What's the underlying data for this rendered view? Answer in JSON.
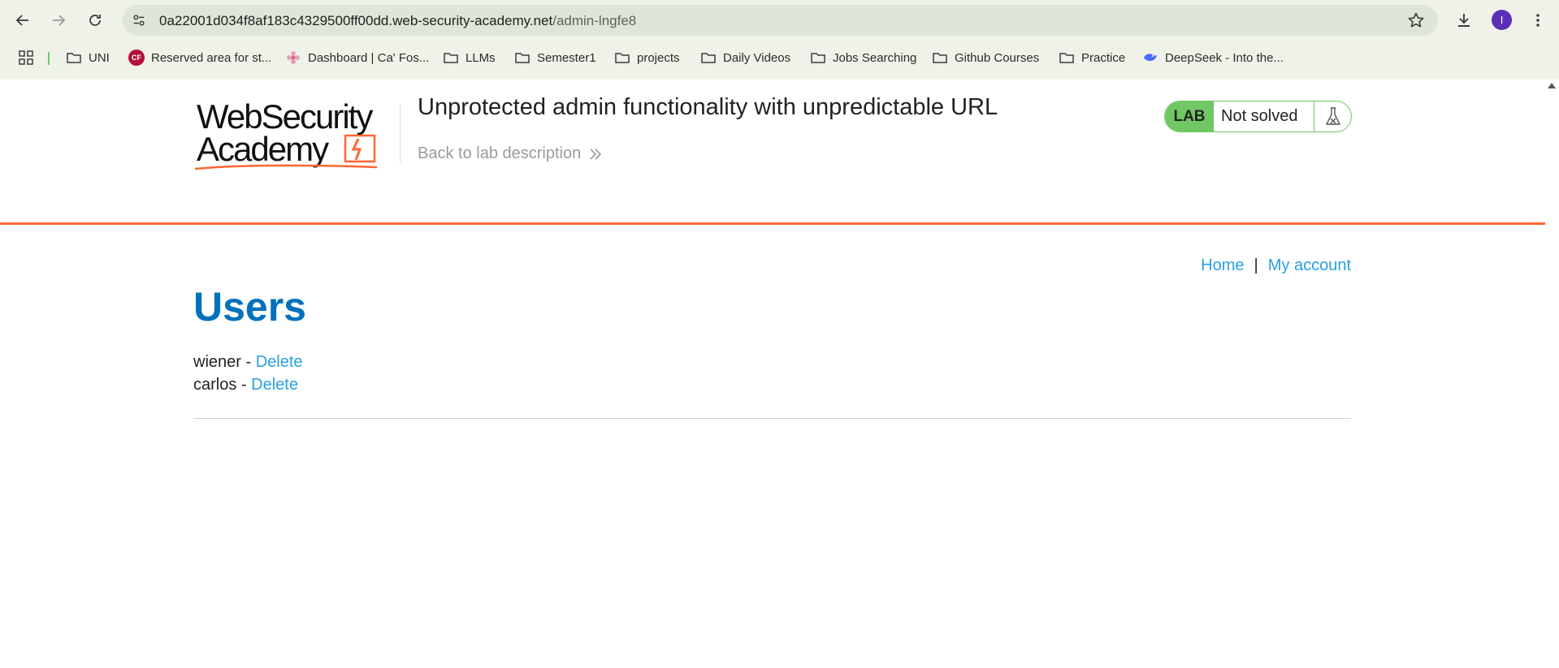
{
  "browser": {
    "url_host": "0a22001d034f8af183c4329500ff00dd.web-security-academy.net",
    "url_path": "/admin-lngfe8",
    "avatar_letter": "I",
    "bookmarks": [
      {
        "label": "UNI",
        "icon": "folder-icon"
      },
      {
        "label": "Reserved area for st...",
        "icon": "cf-favicon"
      },
      {
        "label": "Dashboard | Ca' Fos...",
        "icon": "flower-favicon"
      },
      {
        "label": "LLMs",
        "icon": "folder-icon"
      },
      {
        "label": "Semester1",
        "icon": "folder-icon"
      },
      {
        "label": "projects",
        "icon": "folder-icon"
      },
      {
        "label": "Daily Videos",
        "icon": "folder-icon"
      },
      {
        "label": "Jobs Searching",
        "icon": "folder-icon"
      },
      {
        "label": "Github Courses",
        "icon": "folder-icon"
      },
      {
        "label": "Practice",
        "icon": "folder-icon"
      },
      {
        "label": "DeepSeek - Into the...",
        "icon": "deepseek-favicon"
      }
    ],
    "cf_favicon_text": "CF"
  },
  "header": {
    "logo_line1": "WebSecurity",
    "logo_line2": "Academy",
    "lab_title": "Unprotected admin functionality with unpredictable URL",
    "back_link": "Back to lab description",
    "lab_tag": "LAB",
    "lab_status": "Not solved"
  },
  "nav": {
    "home": "Home",
    "separator": "|",
    "my_account": "My account"
  },
  "main": {
    "title": "Users",
    "users": [
      {
        "name": "wiener",
        "sep": " - ",
        "action": "Delete"
      },
      {
        "name": "carlos",
        "sep": " - ",
        "action": "Delete"
      }
    ]
  },
  "colors": {
    "accent_orange": "#ff6633",
    "lab_green": "#70c764",
    "title_blue": "#0071bc",
    "link_blue": "#29a1de"
  }
}
